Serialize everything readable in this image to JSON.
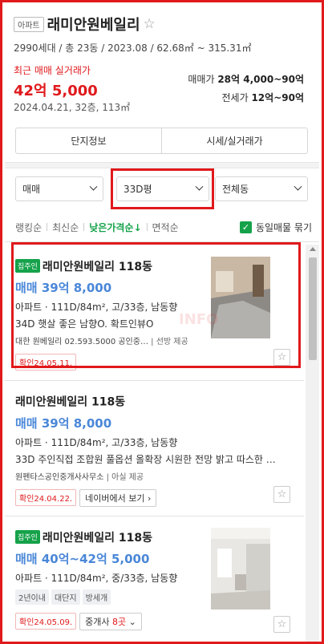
{
  "complex": {
    "type_badge": "아파트",
    "name": "래미안원베일리",
    "info": "2990세대 / 총 23동 / 2023.08 / 62.68㎡ ~ 315.31㎡",
    "recent_label": "최근 매매 실거래가",
    "recent_price": "42억 5,000",
    "recent_detail": "2024.04.21, 32층, 113㎡",
    "sale_range_label": "매매가",
    "sale_range": "28억 4,000~90억",
    "rent_range_label": "전세가",
    "rent_range": "12억~90억",
    "buttons": [
      "단지정보",
      "시세/실거래가"
    ]
  },
  "filters": {
    "trade_type": "매매",
    "size": "33D평",
    "dong": "전체동"
  },
  "sort": {
    "options": [
      "랭킹순",
      "최신순",
      "낮은가격순↓",
      "면적순"
    ],
    "active_index": 2,
    "same_listing_label": "동일매물 묶기",
    "same_listing_checked": true
  },
  "listings": [
    {
      "owner_tag": "집주인",
      "title": "래미안원베일리 118동",
      "price": "매매 39억 8,000",
      "spec": "아파트 · 111D/84m², 고/33층, 남동향",
      "desc": "34D 햇살 좋은 남향O. 확트인뷰O",
      "agent": "대한 원베일리 02.593.5000 공인중…",
      "source": "선방 제공",
      "confirm": "확인24.05.11.",
      "has_image": true
    },
    {
      "owner_tag": "",
      "title": "래미안원베일리 118동",
      "price": "매매 39억 8,000",
      "spec": "아파트 · 111D/84m², 고/33층, 남동향",
      "desc": "33D 주인직접 조합원 풀옵션 올확장 시원한 전망 밝고 따스한 …",
      "agent": "원펜타스공인중개사사무소",
      "source": "아실 제공",
      "confirm": "확인24.04.22.",
      "link": "네이버에서 보기 ›",
      "has_image": false
    },
    {
      "owner_tag": "집주인",
      "title": "래미안원베일리 118동",
      "price": "매매 40억~42억 5,000",
      "spec": "아파트 · 111D/84m², 중/33층, 남동향",
      "chips": [
        "2년이내",
        "대단지",
        "방세개"
      ],
      "confirm": "확인24.05.09.",
      "agent_count_label": "중개사",
      "agent_count": "8곳",
      "has_image": true
    }
  ],
  "watermark": "INFO"
}
